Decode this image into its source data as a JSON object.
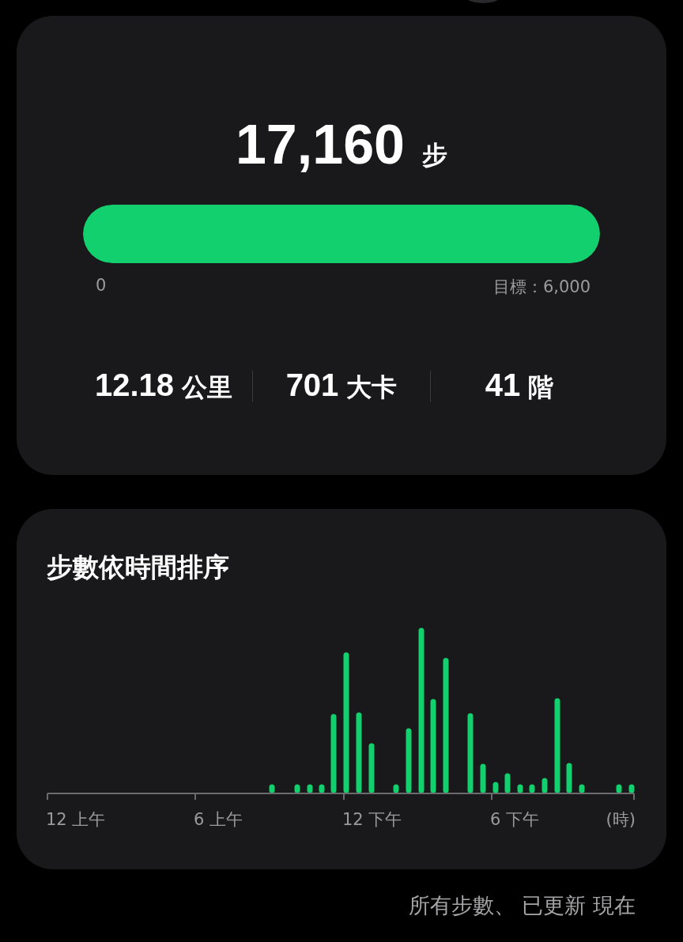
{
  "summary": {
    "steps": "17,160",
    "steps_unit": "步",
    "progress": {
      "level": 1,
      "min_label": "0",
      "goal_label": "目標：6,000"
    },
    "stats": [
      {
        "value": "12.18",
        "unit": "公里"
      },
      {
        "value": "701",
        "unit": "大卡"
      },
      {
        "value": "41",
        "unit": "階"
      }
    ]
  },
  "hourly": {
    "title": "步數依時間排序",
    "x_labels": [
      "12 上午",
      "6 上午",
      "12 下午",
      "6 下午"
    ],
    "x_unit": "(時)"
  },
  "footer": {
    "text": "所有步數、 已更新 現在"
  }
}
